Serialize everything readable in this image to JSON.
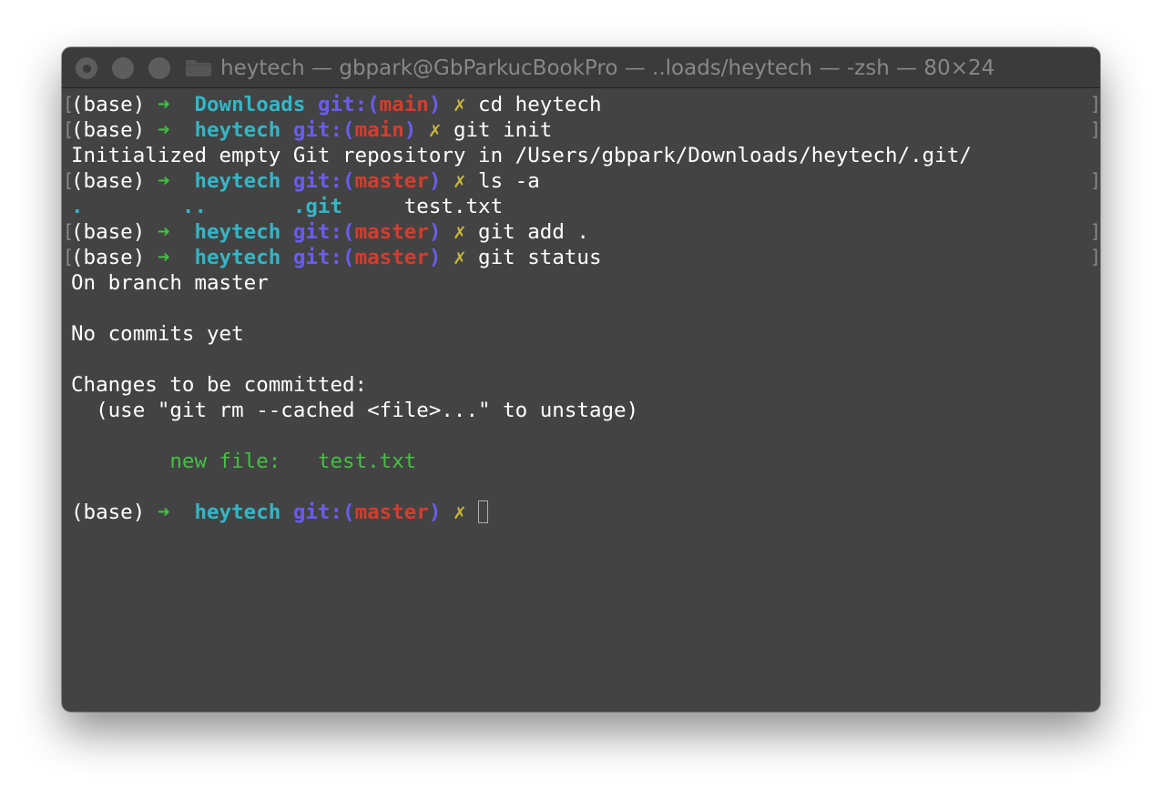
{
  "window": {
    "title": "heytech — gbpark@GbParkucBookPro — ..loads/heytech — -zsh — 80×24"
  },
  "terminal": {
    "prompt_base": "(base)",
    "prompt_arrow": "➜",
    "git_prefix": "git:(",
    "git_suffix": ")",
    "dirty_mark": "✗",
    "bracket_left": "[",
    "bracket_right": "]",
    "lines": [
      {
        "dir": "Downloads",
        "branch": "main",
        "command": "cd heytech"
      },
      {
        "dir": "heytech",
        "branch": "main",
        "command": "git init"
      },
      {
        "output": "Initialized empty Git repository in /Users/gbpark/Downloads/heytech/.git/"
      },
      {
        "dir": "heytech",
        "branch": "master",
        "command": "ls -a"
      },
      {
        "ls": {
          "dot": ".",
          "dotdot": "..",
          "git": ".git",
          "file": "test.txt"
        }
      },
      {
        "dir": "heytech",
        "branch": "master",
        "command": "git add ."
      },
      {
        "dir": "heytech",
        "branch": "master",
        "command": "git status"
      },
      {
        "output": "On branch master"
      },
      {
        "output": "No commits yet"
      },
      {
        "output": "Changes to be committed:"
      },
      {
        "output": "  (use \"git rm --cached <file>...\" to unstage)"
      },
      {
        "new_file_label": "new file:",
        "new_file_name": "test.txt"
      },
      {
        "dir": "heytech",
        "branch": "master",
        "command": ""
      }
    ]
  },
  "colors": {
    "background": "#434343",
    "arrow": "#40c13f",
    "directory": "#33b6c7",
    "git": "#6b5cf0",
    "branch": "#d33d2f",
    "dirty_mark": "#c8b83a",
    "staged_file": "#45c044"
  }
}
